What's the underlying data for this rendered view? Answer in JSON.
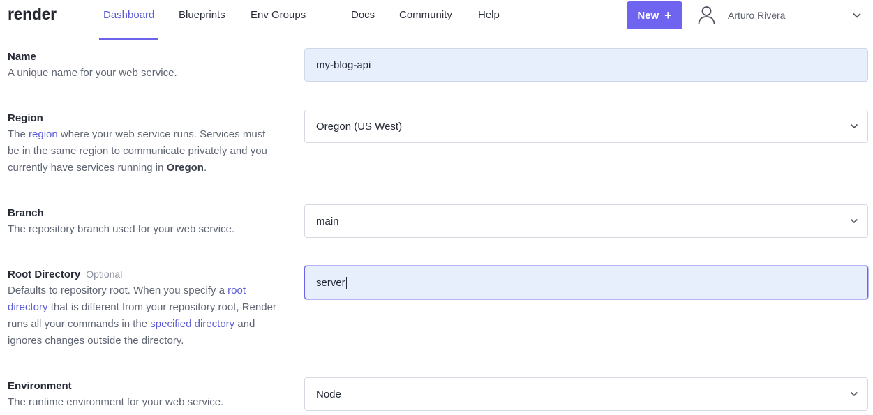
{
  "header": {
    "logo": "render",
    "nav": [
      {
        "label": "Dashboard",
        "active": true
      },
      {
        "label": "Blueprints"
      },
      {
        "label": "Env Groups"
      },
      {
        "label": "Docs"
      },
      {
        "label": "Community"
      },
      {
        "label": "Help"
      }
    ],
    "new_button": {
      "label": "New",
      "icon": "plus-icon"
    },
    "user": {
      "name": "Arturo Rivera",
      "icon": "user-icon"
    },
    "accent_color": "#6e64f0"
  },
  "form": {
    "name": {
      "label": "Name",
      "description": "A unique name for your web service.",
      "value": "my-blog-api"
    },
    "region": {
      "label": "Region",
      "desc_prefix": "The ",
      "desc_link": "region",
      "desc_mid": " where your web service runs. Services must be in the same region to communicate privately and you currently have services running in ",
      "desc_bold": "Oregon",
      "desc_suffix": ".",
      "value": "Oregon (US West)"
    },
    "branch": {
      "label": "Branch",
      "description": "The repository branch used for your web service.",
      "value": "main"
    },
    "root_directory": {
      "label": "Root Directory",
      "optional": "Optional",
      "desc_part1": "Defaults to repository root. When you specify a ",
      "desc_link1": "root directory",
      "desc_part2": " that is different from your repository root, Render runs all your commands in the ",
      "desc_link2": "specified directory",
      "desc_part3": " and ignores changes outside the directory.",
      "value": "server"
    },
    "environment": {
      "label": "Environment",
      "description": "The runtime environment for your web service.",
      "value": "Node"
    }
  }
}
